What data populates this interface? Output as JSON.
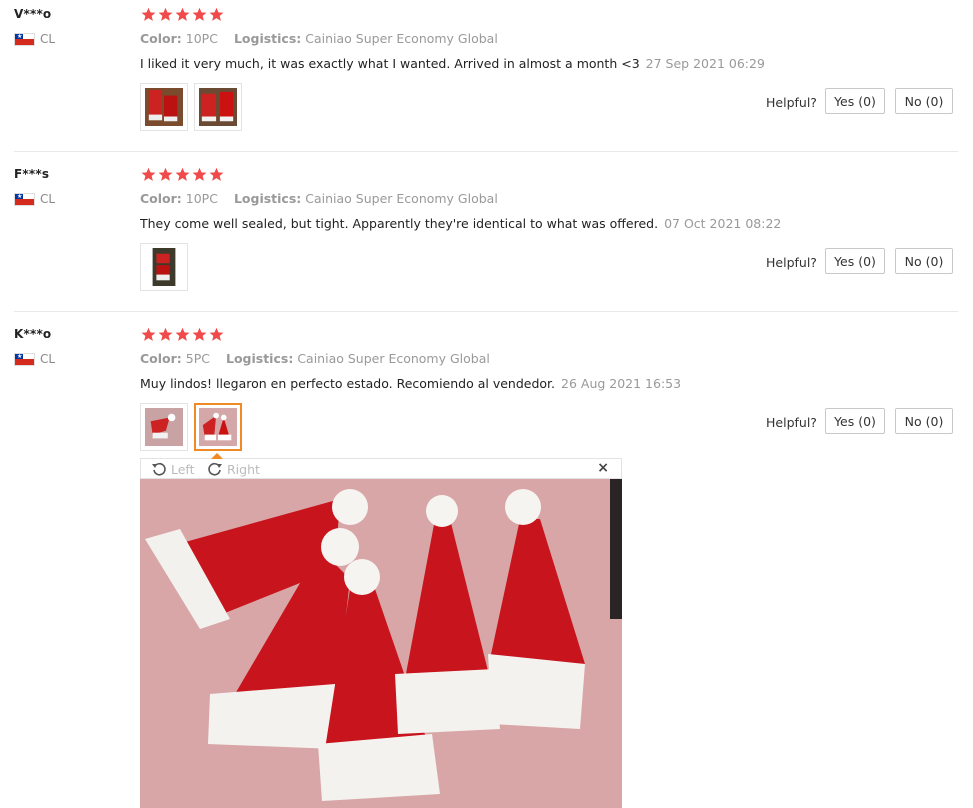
{
  "reviews": [
    {
      "user": "V***o",
      "country": "CL",
      "rating": 5,
      "color_label": "Color:",
      "color_value": "10PC",
      "logistics_label": "Logistics:",
      "logistics_value": "Cainiao Super Economy Global",
      "text": "I liked it very much, it was exactly what I wanted. Arrived in almost a month <3",
      "date": "27 Sep 2021 06:29",
      "helpful_label": "Helpful?",
      "yes_label": "Yes (0)",
      "no_label": "No (0)"
    },
    {
      "user": "F***s",
      "country": "CL",
      "rating": 5,
      "color_label": "Color:",
      "color_value": "10PC",
      "logistics_label": "Logistics:",
      "logistics_value": "Cainiao Super Economy Global",
      "text": "They come well sealed, but tight. Apparently they're identical to what was offered.",
      "date": "07 Oct 2021 08:22",
      "helpful_label": "Helpful?",
      "yes_label": "Yes (0)",
      "no_label": "No (0)"
    },
    {
      "user": "K***o",
      "country": "CL",
      "rating": 5,
      "color_label": "Color:",
      "color_value": "5PC",
      "logistics_label": "Logistics:",
      "logistics_value": "Cainiao Super Economy Global",
      "text": "Muy lindos! llegaron en perfecto estado. Recomiendo al vendedor.",
      "date": "26 Aug 2021 16:53",
      "helpful_label": "Helpful?",
      "yes_label": "Yes (0)",
      "no_label": "No (0)"
    }
  ],
  "viewer": {
    "rotate_left_label": "Left",
    "rotate_right_label": "Right",
    "close_label": "×"
  },
  "colors": {
    "star": "#f04a4a",
    "accent": "#f08a24"
  }
}
